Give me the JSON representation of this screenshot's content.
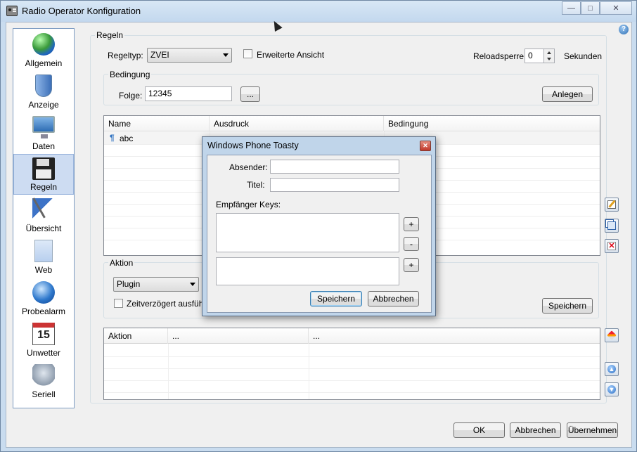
{
  "window": {
    "title": "Radio Operator Konfiguration",
    "minimize": "—",
    "maximize": "□",
    "close": "✕"
  },
  "sidebar": {
    "items": [
      {
        "label": "Allgemein",
        "icon": "globe-icon"
      },
      {
        "label": "Anzeige",
        "icon": "shield-icon"
      },
      {
        "label": "Daten",
        "icon": "monitor-icon"
      },
      {
        "label": "Regeln",
        "icon": "floppy-disk-icon",
        "active": true
      },
      {
        "label": "Übersicht",
        "icon": "flag-icon"
      },
      {
        "label": "Web",
        "icon": "page-icon"
      },
      {
        "label": "Probealarm",
        "icon": "alarm-globe-icon"
      },
      {
        "label": "Unwetter",
        "icon": "calendar-icon",
        "badge": "15"
      },
      {
        "label": "Seriell",
        "icon": "weather-cloud-icon"
      }
    ]
  },
  "help": "?",
  "regeln": {
    "group_title": "Regeln",
    "regeltyp_label": "Regeltyp:",
    "regeltyp_value": "ZVEI",
    "erweiterte_label": "Erweiterte Ansicht",
    "reloadsperre_label": "Reloadsperre:",
    "reloadsperre_value": "0",
    "sekunden_label": "Sekunden",
    "bedingung": {
      "group_title": "Bedingung",
      "folge_label": "Folge:",
      "folge_value": "12345",
      "browse_label": "...",
      "anlegen_label": "Anlegen"
    },
    "table": {
      "columns": [
        "Name",
        "Ausdruck",
        "Bedingung"
      ],
      "rows": [
        {
          "name": "abc"
        }
      ]
    },
    "aktion": {
      "group_title": "Aktion",
      "plugin_value": "Plugin",
      "zeitverzoegert_label": "Zeitverzögert ausführen",
      "speichern_label": "Speichern"
    },
    "aktion_table": {
      "columns": [
        "Aktion",
        "...",
        "..."
      ]
    }
  },
  "dialog": {
    "title": "Windows Phone Toasty",
    "close": "✕",
    "absender_label": "Absender:",
    "titel_label": "Titel:",
    "empfaenger_label": "Empfänger Keys:",
    "add_label": "+",
    "remove_label": "-",
    "add2_label": "+",
    "speichern_label": "Speichern",
    "abbrechen_label": "Abbrechen"
  },
  "footer": {
    "ok_label": "OK",
    "abbrechen_label": "Abbrechen",
    "uebernehmen_label": "Übernehmen"
  },
  "calendar_day": "15"
}
